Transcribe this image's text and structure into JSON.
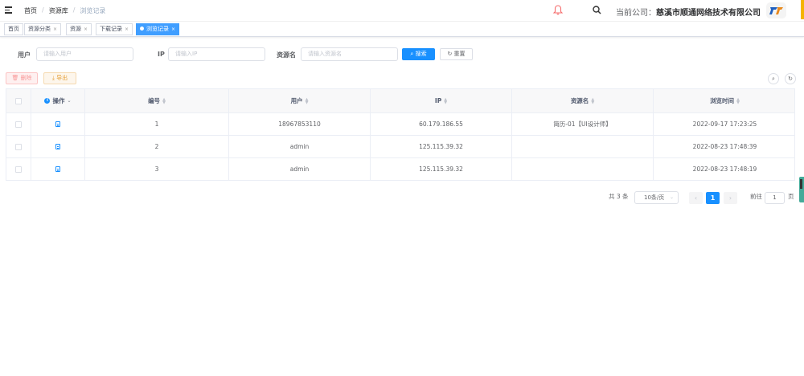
{
  "header": {
    "breadcrumb": [
      "首页",
      "资源库",
      "浏览记录"
    ],
    "company_label": "当前公司：",
    "company_name": "慈溪市顺通网络技术有限公司"
  },
  "tags": [
    {
      "label": "首页"
    },
    {
      "label": "资源分类"
    },
    {
      "label": "资源"
    },
    {
      "label": "下载记录"
    },
    {
      "label": "浏览记录",
      "active": true
    }
  ],
  "filters": {
    "user_label": "用户",
    "user_placeholder": "请输入用户",
    "ip_label": "IP",
    "ip_placeholder": "请输入IP",
    "resource_label": "资源名",
    "resource_placeholder": "请输入资源名",
    "search_label": "搜索",
    "reset_label": "重置"
  },
  "toolbar": {
    "delete_label": "删除",
    "export_label": "导出"
  },
  "table": {
    "columns": [
      "操作",
      "编号",
      "用户",
      "IP",
      "资源名",
      "浏览时间"
    ],
    "rows": [
      {
        "id": "1",
        "user": "18967853110",
        "ip": "60.179.186.55",
        "resource": "简历-01【UI设计师】",
        "time": "2022-09-17 17:23:25"
      },
      {
        "id": "2",
        "user": "admin",
        "ip": "125.115.39.32",
        "resource": "",
        "time": "2022-08-23 17:48:39"
      },
      {
        "id": "3",
        "user": "admin",
        "ip": "125.115.39.32",
        "resource": "",
        "time": "2022-08-23 17:48:19"
      }
    ]
  },
  "pagination": {
    "total_text": "共 3 条",
    "page_size": "10条/页",
    "current_page": "1",
    "goto_label": "前往",
    "goto_value": "1",
    "page_suffix": "页"
  },
  "colors": {
    "primary": "#1890ff",
    "danger": "#f89898",
    "warning": "#e6a23c"
  }
}
